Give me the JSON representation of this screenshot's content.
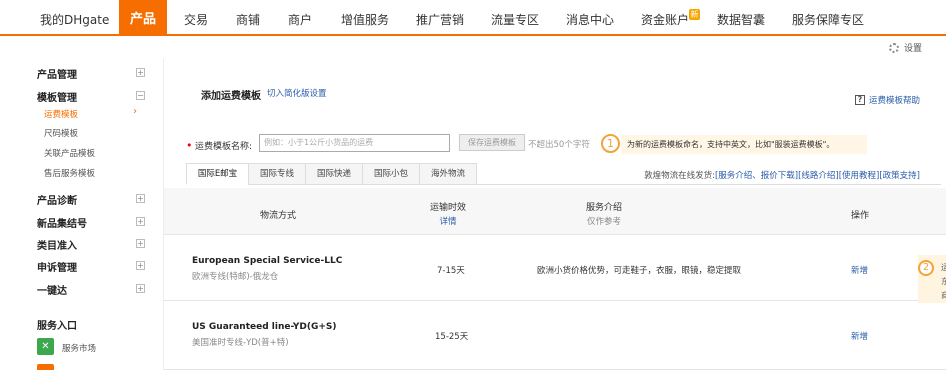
{
  "topnav": {
    "items": [
      {
        "label": "我的DHgate",
        "active": false
      },
      {
        "label": "产品",
        "active": true
      },
      {
        "label": "交易",
        "active": false
      },
      {
        "label": "商铺",
        "active": false
      },
      {
        "label": "商户",
        "active": false
      },
      {
        "label": "增值服务",
        "active": false
      },
      {
        "label": "推广营销",
        "active": false
      },
      {
        "label": "流量专区",
        "active": false
      },
      {
        "label": "消息中心",
        "active": false
      },
      {
        "label": "资金账户",
        "active": false
      },
      {
        "label": "数据智囊",
        "active": false
      },
      {
        "label": "服务保障专区",
        "active": false
      }
    ],
    "badge": "新"
  },
  "settings_label": "设置",
  "sidebar": {
    "product_mgmt": "产品管理",
    "template_mgmt": "模板管理",
    "template_subs": [
      "运费模板",
      "尺码模板",
      "关联产品模板",
      "售后服务模板"
    ],
    "product_diag": "产品诊断",
    "new_collection": "新品集结号",
    "category_access": "类目准入",
    "appeal_mgmt": "申诉管理",
    "one_click": "一键达",
    "service_entry": "服务入口",
    "service_market": "服务市场"
  },
  "main": {
    "title": "添加运费模板",
    "switch_link": "切入简化版设置",
    "help_link": "运费模板帮助",
    "name_label": "运费模板名称:",
    "name_placeholder": "例如：小于1公斤小货品的运费",
    "save_button": "保存运费模板",
    "limit_hint": "不超出50个字符",
    "tip_number": "1",
    "tip_text": "为新的运费模板命名，支持中英文，比如\"服装运费模板\"。",
    "tabs": [
      "国际E邮宝",
      "国际专线",
      "国际快递",
      "国际小包",
      "海外物流"
    ],
    "carrier_links": {
      "prefix": "敦煌物流在线发货:",
      "links": [
        "[服务介绍、报价下载]",
        "[线路介绍]",
        "[使用教程]",
        "[政策支持]"
      ]
    },
    "table_headers": {
      "method": "物流方式",
      "time": "运输时效",
      "time_sub": "详情",
      "intro": "服务介绍",
      "intro_sub": "仅作参考",
      "action": "操作"
    },
    "rows": [
      {
        "name": "European Special Service-LLC",
        "sub": "欧洲专线(特邮)-俄龙仓",
        "time": "7-15天",
        "intro": "欧洲小货价格优势，可走鞋子，衣服，眼镜，稳定提取",
        "action": "新增"
      },
      {
        "name": "US Guaranteed line-YD(G+S)",
        "sub": "美国准时专线-YD(普+特)",
        "time": "15-25天",
        "intro": "",
        "action": "新增"
      }
    ],
    "float_tip": {
      "number": "2",
      "lines": [
        "运",
        "东",
        "商"
      ]
    }
  }
}
